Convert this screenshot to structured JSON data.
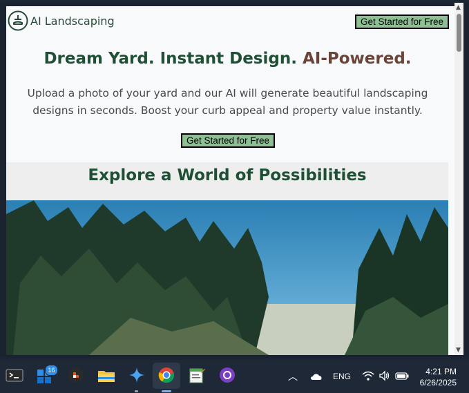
{
  "site": {
    "logo_text": "AI Landscaping",
    "cta_top": "Get Started for Free",
    "hero_title_main": "Dream Yard. Instant Design.",
    "hero_title_accent": "AI-Powered.",
    "hero_desc": "Upload a photo of your yard and our AI will generate beautiful landscaping designs in seconds. Boost your curb appeal and property value instantly.",
    "cta_mid": "Get Started for Free",
    "explore_title": "Explore a World of Possibilities"
  },
  "taskbar": {
    "icons": [
      "terminal-icon",
      "store-icon",
      "app-icon",
      "file-explorer-icon",
      "copilot-icon",
      "chrome-icon",
      "notepad-icon",
      "github-icon"
    ],
    "store_badge": "16",
    "lang": "ENG",
    "time": "4:21 PM",
    "date": "6/26/2025"
  },
  "colors": {
    "accent_green": "#1f4f35",
    "accent_brown": "#6a4438",
    "button_bg": "#8fbf94"
  }
}
